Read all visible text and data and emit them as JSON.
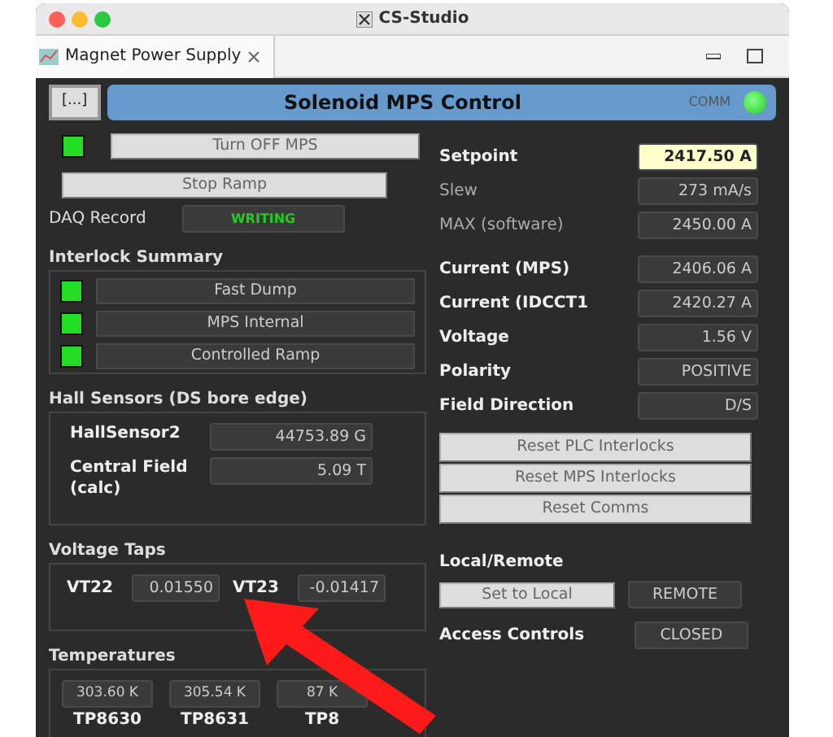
{
  "window": {
    "title": "CS-Studio",
    "tab": {
      "label": "Magnet Power Supply"
    }
  },
  "header": {
    "menu_button": "[...]",
    "title": "Solenoid MPS Control",
    "comm_label": "COMM",
    "comm_on": true
  },
  "controls": {
    "mps_on": true,
    "turn_off": "Turn OFF MPS",
    "stop": "Stop Ramp",
    "daq": {
      "label": "DAQ Record",
      "value": "WRITING"
    }
  },
  "interlocks": {
    "title": "Interlock Summary",
    "items": [
      {
        "label": "Fast Dump",
        "ok": true
      },
      {
        "label": "MPS Internal",
        "ok": true
      },
      {
        "label": "Controlled Ramp",
        "ok": true
      }
    ]
  },
  "hall": {
    "title": "Hall Sensors (DS bore edge)",
    "rows": [
      {
        "label": "HallSensor2",
        "value": "44753.89 G"
      },
      {
        "label": "Central Field (calc)",
        "value": "5.09 T"
      }
    ]
  },
  "voltage_taps": {
    "title": "Voltage Taps",
    "items": [
      {
        "label": "VT22",
        "value": "0.01550"
      },
      {
        "label": "VT23",
        "value": "-0.01417"
      }
    ]
  },
  "temperatures": {
    "title": "Temperatures",
    "items": [
      {
        "value": "303.60 K",
        "label": "TP8630"
      },
      {
        "value": "305.54 K",
        "label": "TP8631"
      },
      {
        "value": "87 K",
        "label": "TP8"
      }
    ]
  },
  "readbacks": [
    {
      "kind": "input",
      "label": "Setpoint",
      "value": "2417.50 A"
    },
    {
      "kind": "limit",
      "label": "Slew",
      "value": "273 mA/s"
    },
    {
      "kind": "limit",
      "label": "MAX (software)",
      "value": "2450.00 A"
    },
    {
      "kind": "readback",
      "label": "Current (MPS)",
      "value": "2406.06 A"
    },
    {
      "kind": "readback",
      "label": "Current (IDCCT1",
      "value": "2420.27 A"
    },
    {
      "kind": "readback",
      "label": "Voltage",
      "value": "1.56 V"
    },
    {
      "kind": "readback",
      "label": "Polarity",
      "value": "POSITIVE"
    },
    {
      "kind": "readback",
      "label": "Field Direction",
      "value": "D/S"
    }
  ],
  "reset_buttons": [
    "Reset PLC Interlocks",
    "Reset MPS Interlocks",
    "Reset Comms"
  ],
  "local_remote": {
    "title": "Local/Remote",
    "button": "Set to Local",
    "status": "REMOTE"
  },
  "access": {
    "label": "Access Controls",
    "value": "CLOSED"
  }
}
